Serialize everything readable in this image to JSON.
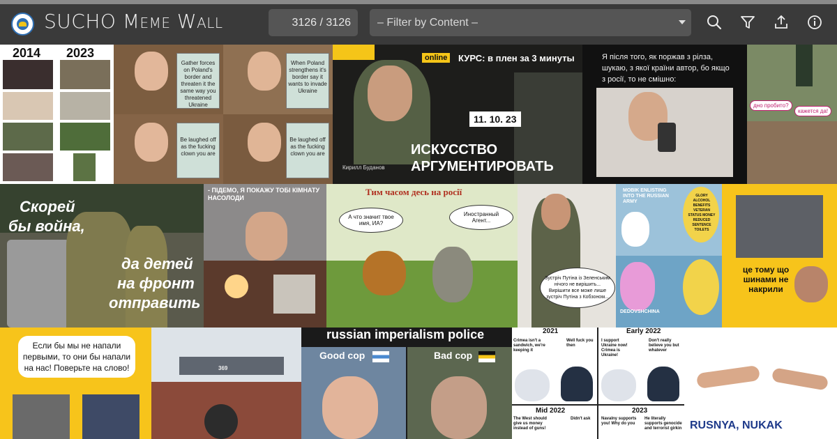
{
  "app": {
    "title": "SUCHO Meme Wall"
  },
  "toolbar": {
    "counter": "3126 / 3126",
    "filter_placeholder": "– Filter by Content –",
    "icons": [
      "search-icon",
      "filter-icon",
      "upload-icon",
      "info-icon"
    ]
  },
  "colors": {
    "topbar": "#3a3a3a",
    "control": "#555555",
    "ukraine_yellow": "#f7c41b"
  },
  "memes": {
    "m1": {
      "left_year": "2014",
      "right_year": "2023"
    },
    "m2": {
      "panel1": "Gather forces on Poland's border and threaten it the same way you threatened Ukraine",
      "panel2": "When Poland strengthens it's border say it wants to invade Ukraine",
      "panel3": "Be laughed off as the fucking clown you are",
      "panel4": "Be laughed off as the fucking clown you are"
    },
    "m3": {
      "online": "online",
      "course": "КУРС: в плен за 3 минуты",
      "date": "11. 10. 23",
      "headline1": "ИСКУССТВО",
      "headline2": "АРГУМЕНТИРОВАТЬ",
      "person": "Кирилл Буданов"
    },
    "m4": {
      "text": "Я після того, як поржав з рілза, шукаю, з якої країни автор, бо якщо з росії, то не смішно:"
    },
    "m5": {
      "bubble1": "дно пробито?",
      "bubble2": "кажется да!"
    },
    "m6": {
      "line1": "Скорей",
      "line2": "бы война,",
      "line3": "да детей",
      "line4": "на фронт",
      "line5": "отправить"
    },
    "m7": {
      "caption": "- ПІДЕМО, Я ПОКАЖУ ТОБІ КІМНАТУ НАСОЛОДИ"
    },
    "m8": {
      "title": "Тим часом десь на росії",
      "bubble_left": "А что значит твое имя, ИА?",
      "bubble_right": "Иностранный Агент..."
    },
    "m9": {
      "bubble": "Зустріч Путіна із Зеленським нічого не вирішить... Вирішити все може лише зустріч Путіна з Кобзоном..."
    },
    "m10": {
      "label1": "MOBIK ENLISTING INTO THE RUSSIAN ARMY",
      "list": "GLORY ALCOHOL BENEFITS VETERAN STATUS MONEY REDUCED SENTENCE TOILETS",
      "label2": "DEDOVSHCHINA"
    },
    "m11": {
      "caption": "це тому що шинами не накрили"
    },
    "m12": {
      "bubble": "Если бы мы не напали первыми, то они бы напали на нас! Поверьте на слово!"
    },
    "m13": {
      "hull": "369"
    },
    "m14": {
      "title": "russian imperialism police",
      "good": "Good cop",
      "bad": "Bad cop"
    },
    "m15": {
      "y1": "2021",
      "y2": "Early 2022",
      "y3": "Mid 2022",
      "y4": "2023",
      "t1": "Crimea isn't a sandwich, we're keeping it",
      "t2": "Well fuck you then",
      "t3": "I support Ukraine now! Crimea is Ukraine!",
      "t4": "Don't really believe you but whatever",
      "t5": "The West should give us money instead of guns!",
      "t6": "Didn't ask",
      "t7": "Navalny supports you! Why do you",
      "t8": "He literally supports genocide and terrorist girkin"
    },
    "m16": {
      "caption": "RUSNYA, NUKAK"
    }
  }
}
